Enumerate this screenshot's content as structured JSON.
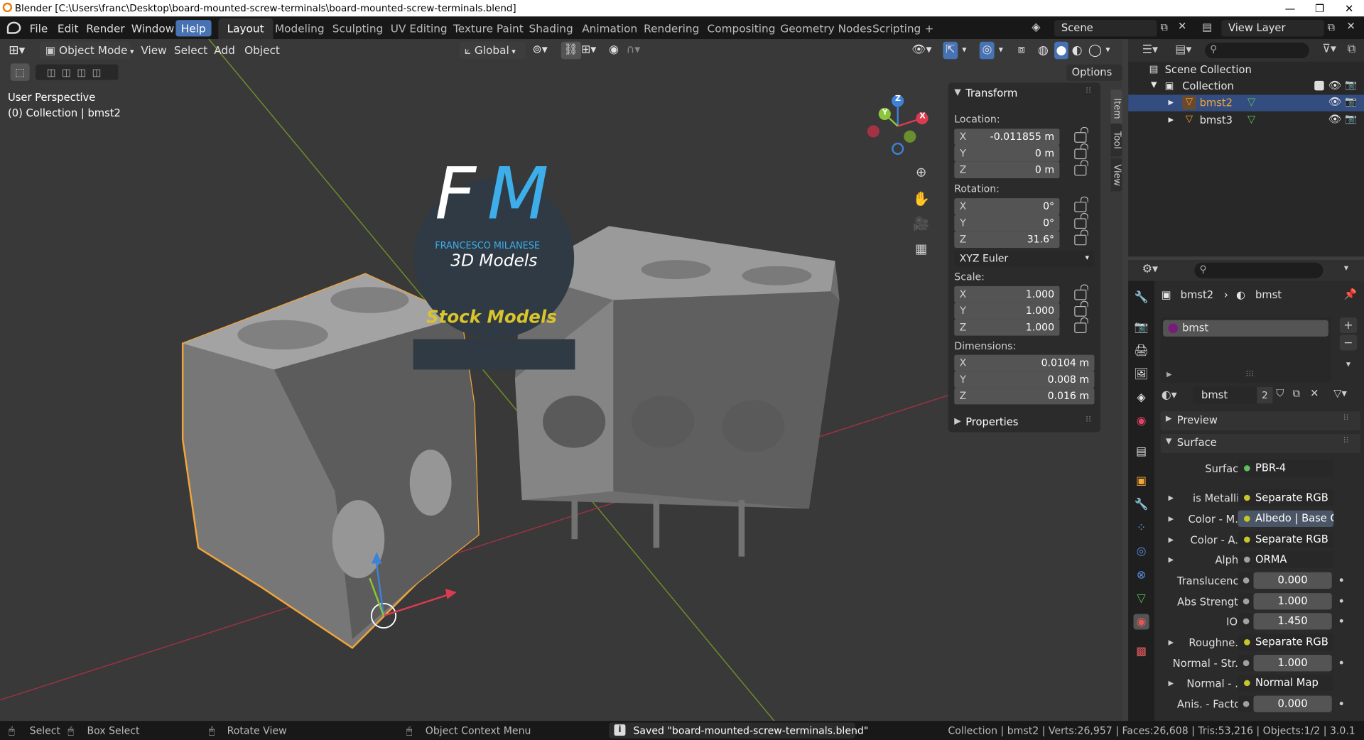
{
  "window": {
    "title": "Blender [C:\\Users\\franc\\Desktop\\board-mounted-screw-terminals\\board-mounted-screw-terminals.blend]",
    "controls": [
      "—",
      "❐",
      "✕"
    ]
  },
  "menubar": {
    "items": [
      "File",
      "Edit",
      "Render",
      "Window",
      "Help"
    ]
  },
  "workspaces": [
    "Layout",
    "Modeling",
    "Sculpting",
    "UV Editing",
    "Texture Paint",
    "Shading",
    "Animation",
    "Rendering",
    "Compositing",
    "Geometry Nodes",
    "Scripting",
    "+"
  ],
  "scene": {
    "name": "Scene",
    "view_layer": "View Layer"
  },
  "viewport": {
    "mode": "Object Mode",
    "menus": [
      "View",
      "Select",
      "Add",
      "Object"
    ],
    "orientation": "Global",
    "options": "Options",
    "perspective": "User Perspective",
    "collection_info": "(0) Collection | bmst2",
    "gizmo": {
      "x": "X",
      "y": "Y",
      "z": "Z"
    },
    "watermark": {
      "initials_f": "F",
      "initials_m": "M",
      "name": "FRANCESCO MILANESE",
      "models": "3D Models",
      "stock": "Stock Models"
    }
  },
  "npanel": {
    "title": "Transform",
    "location_label": "Location:",
    "location": [
      {
        "axis": "X",
        "value": "-0.011855 m"
      },
      {
        "axis": "Y",
        "value": "0 m"
      },
      {
        "axis": "Z",
        "value": "0 m"
      }
    ],
    "rotation_label": "Rotation:",
    "rotation": [
      {
        "axis": "X",
        "value": "0°"
      },
      {
        "axis": "Y",
        "value": "0°"
      },
      {
        "axis": "Z",
        "value": "31.6°"
      }
    ],
    "rotation_mode": "XYZ Euler",
    "scale_label": "Scale:",
    "scale": [
      {
        "axis": "X",
        "value": "1.000"
      },
      {
        "axis": "Y",
        "value": "1.000"
      },
      {
        "axis": "Z",
        "value": "1.000"
      }
    ],
    "dimensions_label": "Dimensions:",
    "dimensions": [
      {
        "axis": "X",
        "value": "0.0104 m"
      },
      {
        "axis": "Y",
        "value": "0.008 m"
      },
      {
        "axis": "Z",
        "value": "0.016 m"
      }
    ],
    "properties": "Properties",
    "tabs": [
      "Item",
      "Tool",
      "View"
    ]
  },
  "outliner": {
    "root": "Scene Collection",
    "collection": "Collection",
    "objects": [
      "bmst2",
      "bmst3"
    ]
  },
  "properties": {
    "breadcrumb_object": "bmst2",
    "breadcrumb_material": "bmst",
    "slot": "bmst",
    "material_name": "bmst",
    "users": "2",
    "preview": "Preview",
    "surface_panel": "Surface",
    "rows": [
      {
        "label": "Surface",
        "value": "PBR-4",
        "dot": "#5cc15c",
        "kind": "link"
      },
      {
        "label": "is Metallic",
        "value": "Separate RGB",
        "dot": "#c7c729",
        "kind": "link",
        "exp": true
      },
      {
        "label": "Color - M...",
        "value": "Albedo | Base C...",
        "dot": "#c7c729",
        "kind": "link",
        "exp": true,
        "hl": true
      },
      {
        "label": "Color - A...",
        "value": "Separate RGB",
        "dot": "#c7c729",
        "kind": "link",
        "exp": true
      },
      {
        "label": "Alpha",
        "value": "ORMA",
        "dot": "#a1a1a1",
        "kind": "link",
        "exp": true
      },
      {
        "label": "Translucency",
        "value": "0.000",
        "dot": "#a1a1a1",
        "kind": "num"
      },
      {
        "label": "Abs Strength",
        "value": "1.000",
        "dot": "#a1a1a1",
        "kind": "num"
      },
      {
        "label": "IOR",
        "value": "1.450",
        "dot": "#a1a1a1",
        "kind": "num"
      },
      {
        "label": "Roughne...",
        "value": "Separate RGB",
        "dot": "#c7c729",
        "kind": "link",
        "exp": true
      },
      {
        "label": "Normal - Str...",
        "value": "1.000",
        "dot": "#a1a1a1",
        "kind": "num"
      },
      {
        "label": "Normal - ...",
        "value": "Normal Map",
        "dot": "#c7c729",
        "kind": "link",
        "exp": true
      },
      {
        "label": "Anis. - Factor",
        "value": "0.000",
        "dot": "#a1a1a1",
        "kind": "num"
      }
    ]
  },
  "statusbar": {
    "select": "Select",
    "box_select": "Box Select",
    "rotate": "Rotate View",
    "context": "Object Context Menu",
    "message": "Saved \"board-mounted-screw-terminals.blend\"",
    "stats": "Collection | bmst2 | Verts:26,957 | Faces:26,608 | Tris:53,216 | Objects:1/2 | 3.0.1"
  },
  "colors": {
    "accent": "#4772b3",
    "select_outline": "#f2a53a",
    "x_axis": "#db3b50",
    "y_axis": "#8cc43a",
    "z_axis": "#3d82d8"
  }
}
